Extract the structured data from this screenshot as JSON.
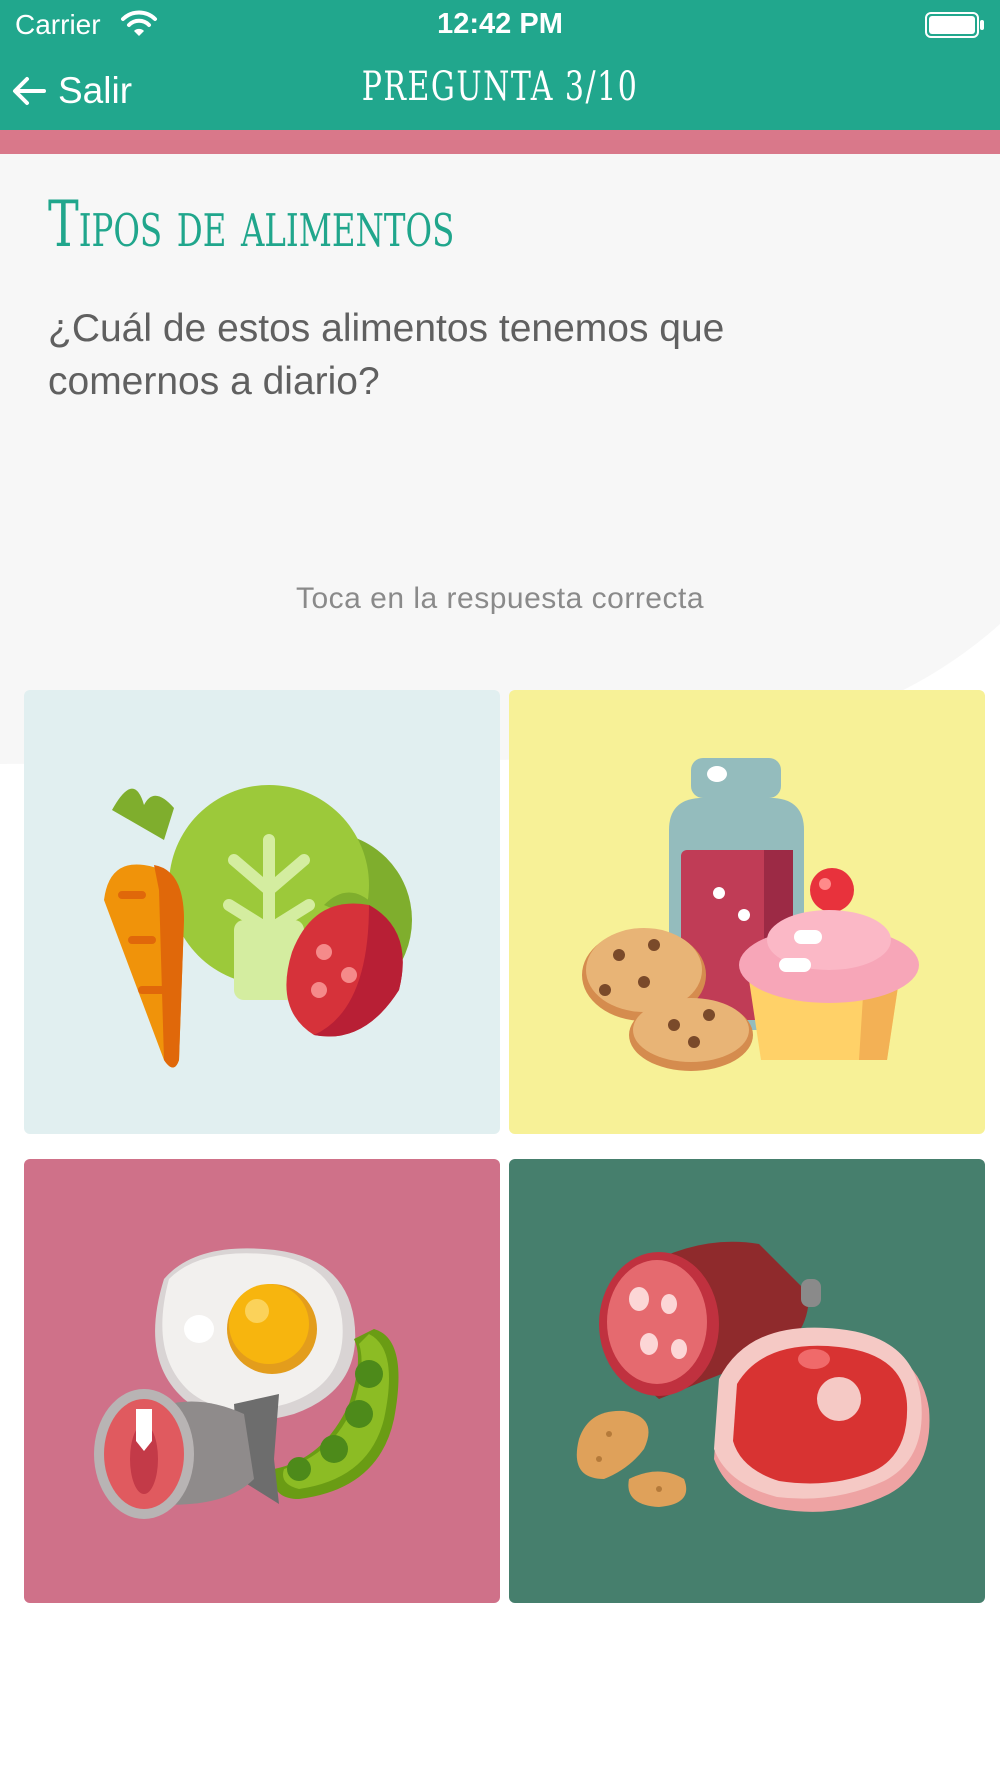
{
  "status_bar": {
    "carrier": "Carrier",
    "time": "12:42 PM"
  },
  "nav": {
    "back_label": "Salir",
    "title": "PREGUNTA 3/10"
  },
  "quiz": {
    "topic": "Tipos de alimentos",
    "question": "¿Cuál de estos alimentos tenemos que comernos a diario?",
    "hint": "Toca en la respuesta correcta",
    "options": [
      {
        "illustration": "vegetables-fruit",
        "background": "#e1eff0"
      },
      {
        "illustration": "sweets-soda-cookies-cupcake",
        "background": "#f7f197"
      },
      {
        "illustration": "egg-fish-peas",
        "background": "#cf7189"
      },
      {
        "illustration": "sausage-meat-peanuts",
        "background": "#467f6d"
      }
    ]
  },
  "colors": {
    "header": "#21a78d",
    "accent_bar": "#d9788a",
    "heading": "#20a68c"
  }
}
